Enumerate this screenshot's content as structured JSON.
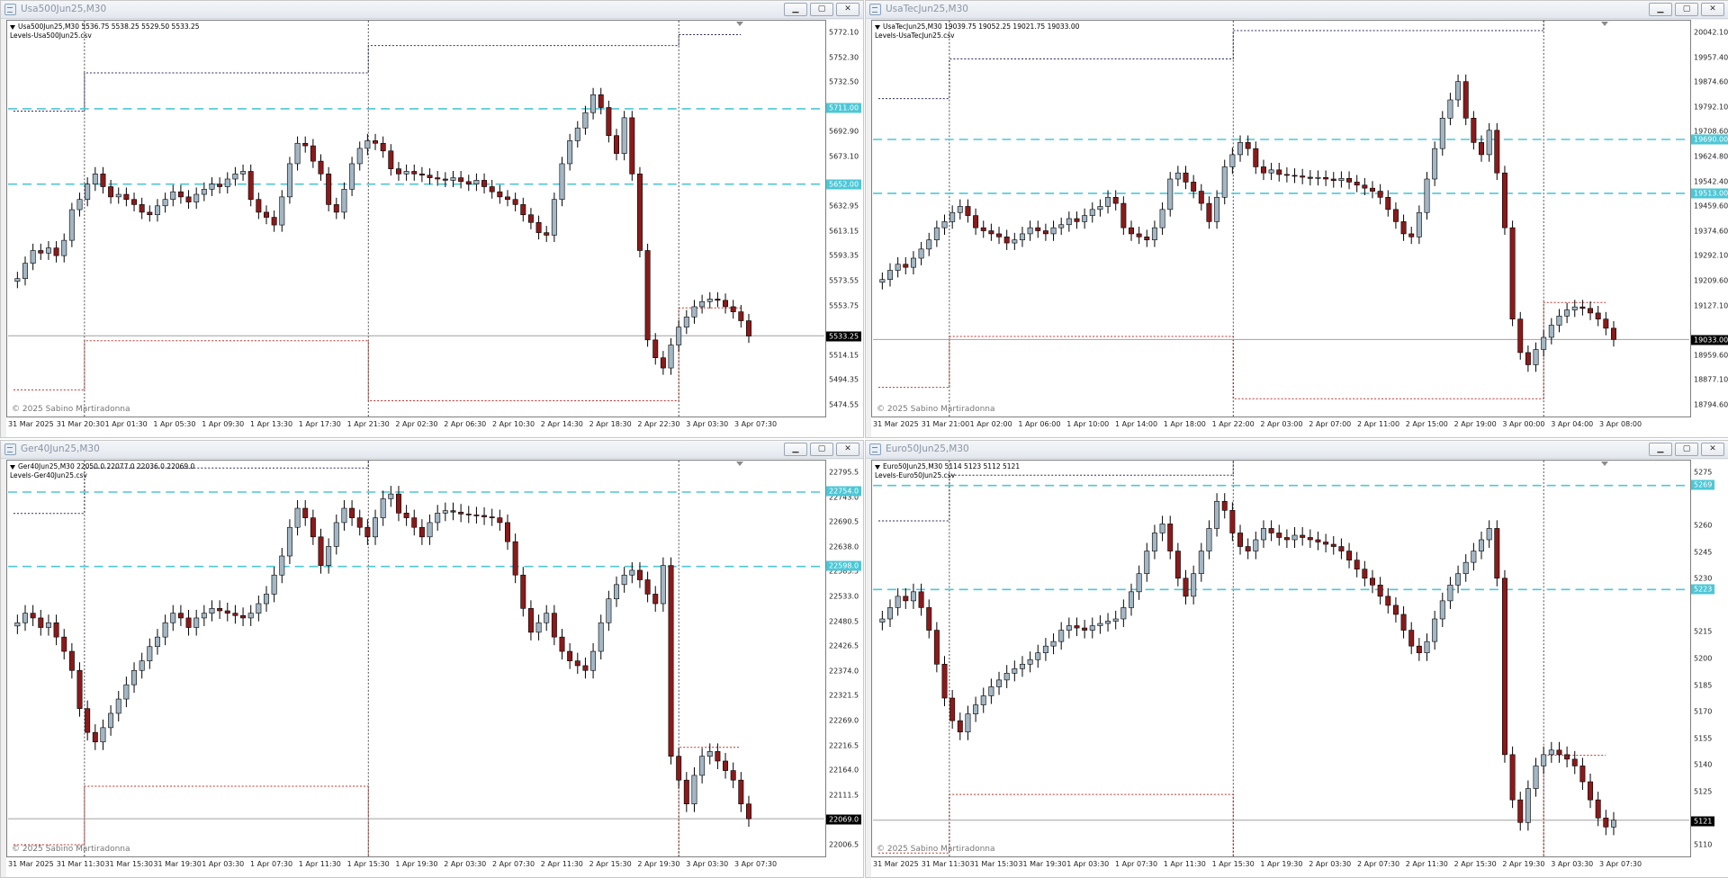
{
  "copyright": "© 2025 Sabino Martiradonna",
  "colors": {
    "bull": "#a3b6c4",
    "bear": "#8b1a1a",
    "wick": "#000000",
    "level_line": "#4dc7d6",
    "upper_band": "#2b2b5a",
    "lower_band": "#c0302a",
    "sep": "#222222",
    "price_line": "#a0a0a0"
  },
  "windows": [
    {
      "title": "Usa500Jun25,M30",
      "info_line1": "Usa500Jun25,M30  5536.75 5538.25 5529.50 5533.25",
      "info_line2": "Levels-Usa500Jun25.csv",
      "y_labels": [
        "5772.10",
        "5752.30",
        "5732.50",
        "5712.70",
        "5692.90",
        "5673.10",
        "5652.00",
        "5632.95",
        "5613.15",
        "5593.35",
        "5573.55",
        "5553.75",
        "5533.25",
        "5514.15",
        "5494.35",
        "5474.55"
      ],
      "price_tag": "5533.25",
      "level_tags": [
        "5711.00",
        "5652.00"
      ],
      "x_labels": [
        "31 Mar 2025",
        "31 Mar 20:30",
        "1 Apr 01:30",
        "1 Apr 05:30",
        "1 Apr 09:30",
        "1 Apr 13:30",
        "1 Apr 17:30",
        "1 Apr 21:30",
        "2 Apr 02:30",
        "2 Apr 06:30",
        "2 Apr 10:30",
        "2 Apr 14:30",
        "2 Apr 18:30",
        "2 Apr 22:30",
        "3 Apr 03:30",
        "3 Apr 07:30"
      ],
      "chart_data": {
        "type": "candlestick",
        "ylim": [
          5470,
          5780
        ],
        "levels": [
          5711.0,
          5652.0
        ],
        "price": 5533.25,
        "closes": [
          5578,
          5590,
          5600,
          5598,
          5602,
          5596,
          5608,
          5632,
          5640,
          5652,
          5660,
          5650,
          5642,
          5644,
          5640,
          5636,
          5630,
          5628,
          5635,
          5640,
          5646,
          5642,
          5638,
          5644,
          5648,
          5652,
          5650,
          5656,
          5660,
          5662,
          5640,
          5630,
          5626,
          5620,
          5642,
          5668,
          5684,
          5682,
          5670,
          5660,
          5636,
          5630,
          5648,
          5668,
          5680,
          5686,
          5684,
          5678,
          5664,
          5660,
          5662,
          5660,
          5659,
          5657,
          5656,
          5655,
          5657,
          5654,
          5652,
          5655,
          5650,
          5646,
          5642,
          5640,
          5636,
          5628,
          5622,
          5614,
          5612,
          5640,
          5668,
          5686,
          5696,
          5708,
          5722,
          5712,
          5690,
          5676,
          5704,
          5660,
          5600,
          5530,
          5516,
          5508,
          5526,
          5540,
          5548,
          5556,
          5560,
          5562,
          5561,
          5556,
          5552,
          5545,
          5533
        ]
      }
    },
    {
      "title": "UsaTecJun25,M30",
      "info_line1": "UsaTecJun25,M30  19039.75 19052.25 19021.75 19033.00",
      "info_line2": "Levels-UsaTecJun25.csv",
      "y_labels": [
        "20042.10",
        "19957.40",
        "19874.60",
        "19792.10",
        "19708.60",
        "19624.80",
        "19542.40",
        "19459.60",
        "19374.60",
        "19292.10",
        "19209.60",
        "19127.10",
        "19033.00",
        "18959.60",
        "18877.10",
        "18794.60"
      ],
      "price_tag": "19033.00",
      "level_tags": [
        "19690.00",
        "19513.00"
      ],
      "x_labels": [
        "31 Mar 2025",
        "31 Mar 21:00",
        "1 Apr 02:00",
        "1 Apr 06:00",
        "1 Apr 10:00",
        "1 Apr 14:00",
        "1 Apr 18:00",
        "1 Apr 22:00",
        "2 Apr 03:00",
        "2 Apr 07:00",
        "2 Apr 11:00",
        "2 Apr 15:00",
        "2 Apr 19:00",
        "3 Apr 00:00",
        "3 Apr 04:00",
        "3 Apr 08:00"
      ],
      "chart_data": {
        "type": "candlestick",
        "ylim": [
          18780,
          20080
        ],
        "levels": [
          19690.0,
          19513.0
        ],
        "price": 19033.0,
        "closes": [
          19230,
          19260,
          19280,
          19270,
          19300,
          19330,
          19360,
          19400,
          19420,
          19450,
          19470,
          19440,
          19400,
          19390,
          19380,
          19370,
          19350,
          19360,
          19380,
          19400,
          19390,
          19380,
          19400,
          19410,
          19430,
          19420,
          19440,
          19460,
          19470,
          19500,
          19480,
          19400,
          19380,
          19370,
          19360,
          19400,
          19460,
          19560,
          19580,
          19550,
          19520,
          19480,
          19420,
          19500,
          19600,
          19640,
          19680,
          19660,
          19600,
          19580,
          19590,
          19575,
          19572,
          19570,
          19566,
          19562,
          19565,
          19560,
          19555,
          19562,
          19550,
          19540,
          19530,
          19520,
          19500,
          19460,
          19420,
          19380,
          19370,
          19450,
          19560,
          19660,
          19760,
          19820,
          19880,
          19760,
          19680,
          19640,
          19720,
          19580,
          19400,
          19100,
          18990,
          18950,
          19000,
          19040,
          19080,
          19110,
          19130,
          19140,
          19135,
          19120,
          19100,
          19070,
          19033
        ]
      }
    },
    {
      "title": "Ger40Jun25,M30",
      "info_line1": "Ger40Jun25,M30  22050.0 22077.0 22036.0 22069.0",
      "info_line2": "Levels-Ger40Jun25.csv",
      "y_labels": [
        "22795.5",
        "22743.0",
        "22690.5",
        "22638.0",
        "22585.5",
        "22533.0",
        "22480.5",
        "22426.5",
        "22374.0",
        "22321.5",
        "22269.0",
        "22216.5",
        "22164.0",
        "22111.5",
        "22069.0",
        "22006.5"
      ],
      "price_tag": "22069.0",
      "level_tags": [
        "22754.0",
        "22598.0"
      ],
      "x_labels": [
        "31 Mar 2025",
        "31 Mar 11:30",
        "31 Mar 15:30",
        "31 Mar 19:30",
        "1 Apr 03:30",
        "1 Apr 07:30",
        "1 Apr 11:30",
        "1 Apr 15:30",
        "1 Apr 19:30",
        "2 Apr 03:30",
        "2 Apr 07:30",
        "2 Apr 11:30",
        "2 Apr 15:30",
        "2 Apr 19:30",
        "3 Apr 03:30",
        "3 Apr 07:30"
      ],
      "chart_data": {
        "type": "candlestick",
        "ylim": [
          21990,
          22820
        ],
        "levels": [
          22754.0,
          22598.0
        ],
        "price": 22069.0,
        "closes": [
          22480,
          22500,
          22490,
          22470,
          22480,
          22450,
          22420,
          22380,
          22300,
          22250,
          22230,
          22260,
          22290,
          22320,
          22350,
          22380,
          22400,
          22430,
          22450,
          22480,
          22500,
          22490,
          22470,
          22490,
          22500,
          22510,
          22505,
          22500,
          22495,
          22490,
          22500,
          22520,
          22540,
          22580,
          22620,
          22680,
          22720,
          22700,
          22660,
          22600,
          22640,
          22690,
          22720,
          22700,
          22680,
          22660,
          22700,
          22740,
          22750,
          22710,
          22700,
          22680,
          22660,
          22690,
          22710,
          22715,
          22712,
          22708,
          22706,
          22705,
          22702,
          22700,
          22690,
          22650,
          22580,
          22510,
          22460,
          22480,
          22500,
          22450,
          22420,
          22400,
          22390,
          22380,
          22420,
          22480,
          22530,
          22560,
          22580,
          22590,
          22570,
          22540,
          22520,
          22600,
          22200,
          22150,
          22100,
          22160,
          22200,
          22210,
          22190,
          22170,
          22150,
          22100,
          22069
        ]
      }
    },
    {
      "title": "Euro50Jun25,M30",
      "info_line1": "Euro50Jun25,M30  5114 5123 5112 5121",
      "info_line2": "Levels-Euro50Jun25.csv",
      "y_labels": [
        "5275",
        "5269",
        "5260",
        "5245",
        "5230",
        "5223",
        "5215",
        "5200",
        "5185",
        "5170",
        "5155",
        "5140",
        "5125",
        "5121",
        "5110"
      ],
      "price_tag": "5121",
      "level_tags": [
        "5269",
        "5223"
      ],
      "x_labels": [
        "31 Mar 2025",
        "31 Mar 11:30",
        "31 Mar 15:30",
        "31 Mar 19:30",
        "1 Apr 03:30",
        "1 Apr 07:30",
        "1 Apr 11:30",
        "1 Apr 15:30",
        "1 Apr 19:30",
        "2 Apr 03:30",
        "2 Apr 07:30",
        "2 Apr 11:30",
        "2 Apr 15:30",
        "2 Apr 19:30",
        "3 Apr 03:30",
        "3 Apr 07:30"
      ],
      "chart_data": {
        "type": "candlestick",
        "ylim": [
          5105,
          5280
        ],
        "levels": [
          5269.0,
          5223.0
        ],
        "price": 5121.0,
        "closes": [
          5210,
          5215,
          5220,
          5218,
          5222,
          5215,
          5205,
          5190,
          5175,
          5165,
          5160,
          5168,
          5172,
          5176,
          5180,
          5183,
          5186,
          5188,
          5190,
          5192,
          5195,
          5198,
          5200,
          5205,
          5207,
          5206,
          5205,
          5207,
          5208,
          5209,
          5210,
          5215,
          5222,
          5230,
          5240,
          5248,
          5252,
          5240,
          5228,
          5220,
          5230,
          5240,
          5250,
          5262,
          5258,
          5248,
          5242,
          5240,
          5245,
          5250,
          5248,
          5246,
          5245,
          5247,
          5246,
          5245,
          5244,
          5243,
          5242,
          5240,
          5236,
          5232,
          5228,
          5225,
          5220,
          5216,
          5212,
          5205,
          5198,
          5195,
          5200,
          5210,
          5218,
          5225,
          5230,
          5235,
          5240,
          5245,
          5250,
          5228,
          5150,
          5130,
          5120,
          5135,
          5145,
          5150,
          5152,
          5150,
          5148,
          5145,
          5138,
          5130,
          5122,
          5118,
          5121
        ]
      }
    }
  ]
}
